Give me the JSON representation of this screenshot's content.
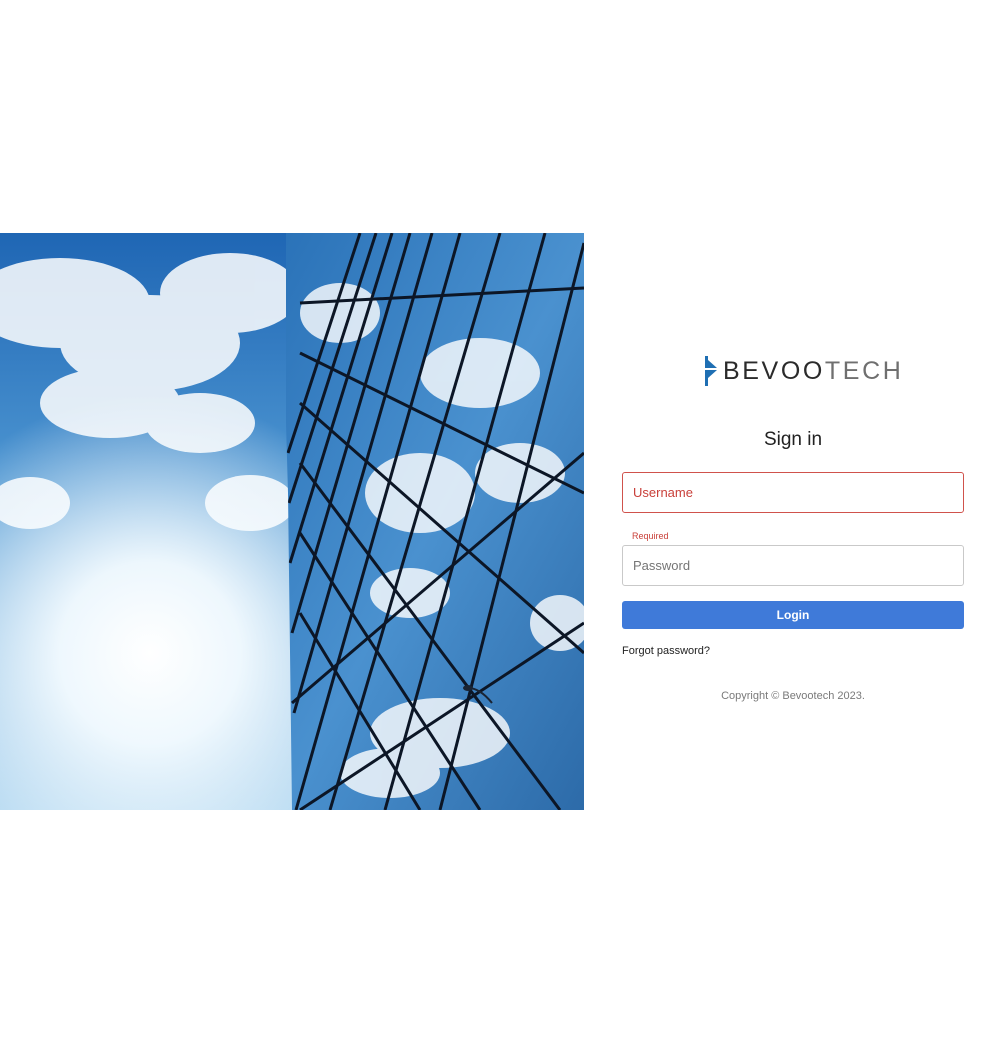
{
  "hero_image": {
    "icon": "building-sky-photo",
    "colors": {
      "sky_top": "#1f66b4",
      "sky_light": "#eef8ff",
      "glass": "#3f86c6",
      "frame": "#0c1626"
    }
  },
  "brand": {
    "icon": "play-mark-icon",
    "name_part_1": "BEVOO",
    "name_part_2": "TECH",
    "colors": {
      "mark": "#1f6fb3",
      "part_1": "#2b2b2b",
      "part_2": "#6f6f6f"
    }
  },
  "login": {
    "title": "Sign in",
    "username": {
      "placeholder": "Username",
      "value": "",
      "helper": "Required",
      "state": "error"
    },
    "password": {
      "placeholder": "Password",
      "value": ""
    },
    "submit_label": "Login",
    "forgot_label": "Forgot password?"
  },
  "footer": {
    "copyright": "Copyright © Bevootech 2023."
  },
  "colors": {
    "primary": "#3f7ad9",
    "error": "#c9403a",
    "error_border": "#d0524c"
  }
}
